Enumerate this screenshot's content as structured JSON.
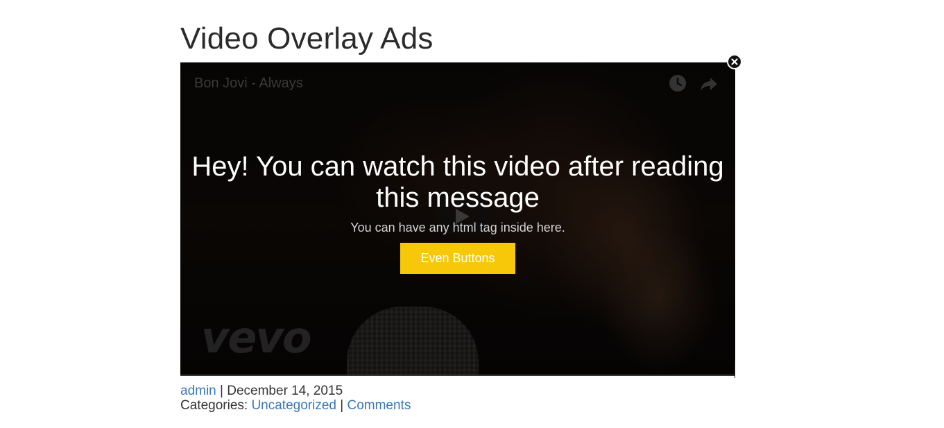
{
  "post": {
    "title": "Video Overlay Ads"
  },
  "video": {
    "title": "Bon Jovi - Always",
    "watermark": "vevo",
    "icons": {
      "watch_later": "clock-icon",
      "share": "share-icon",
      "play": "play-icon"
    }
  },
  "overlay": {
    "headline": "Hey! You can watch this video after reading this message",
    "subtext": "You can have any html tag inside here.",
    "button_label": "Even Buttons",
    "button_color": "#f7c80a",
    "close_icon": "close-icon"
  },
  "meta": {
    "author": "admin",
    "separator": "|",
    "date": "December 14, 2015",
    "categories_label": "Categories:",
    "category": "Uncategorized",
    "comments": "Comments",
    "link_color": "#3a78b5"
  }
}
